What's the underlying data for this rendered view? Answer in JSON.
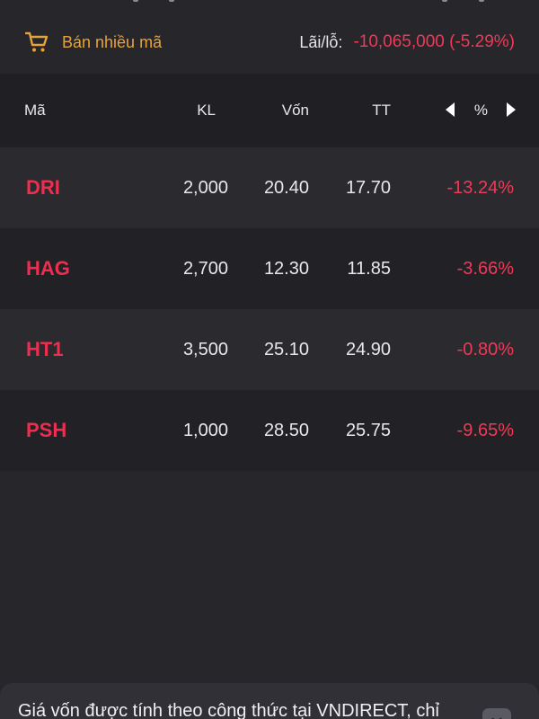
{
  "colors": {
    "background": "#26262b",
    "accent_orange": "#e8a23a",
    "loss_red": "#ee3a57",
    "symbol_red": "#ee2e4e",
    "text": "#e8e8ec"
  },
  "action_bar": {
    "sell_icon": "cart-icon",
    "sell_label": "Bán nhiều mã",
    "pnl_label": "Lãi/lỗ:",
    "pnl_value": "-10,065,000 (-5.29%)"
  },
  "table": {
    "headers": {
      "symbol": "Mã",
      "volume": "KL",
      "cost": "Vốn",
      "market": "TT",
      "percent": "%"
    },
    "nav_icons": [
      "caret-left-icon",
      "caret-right-icon"
    ],
    "rows": [
      {
        "symbol": "DRI",
        "volume": "2,000",
        "cost": "20.40",
        "market": "17.70",
        "percent": "-13.24%"
      },
      {
        "symbol": "HAG",
        "volume": "2,700",
        "cost": "12.30",
        "market": "11.85",
        "percent": "-3.66%"
      },
      {
        "symbol": "HT1",
        "volume": "3,500",
        "cost": "25.10",
        "market": "24.90",
        "percent": "-0.80%"
      },
      {
        "symbol": "PSH",
        "volume": "1,000",
        "cost": "28.50",
        "market": "25.75",
        "percent": "-9.65%"
      }
    ]
  },
  "note": {
    "text": "Giá vốn được tính theo công thức tại VNDIRECT, chỉ",
    "close_icon": "close-icon"
  }
}
